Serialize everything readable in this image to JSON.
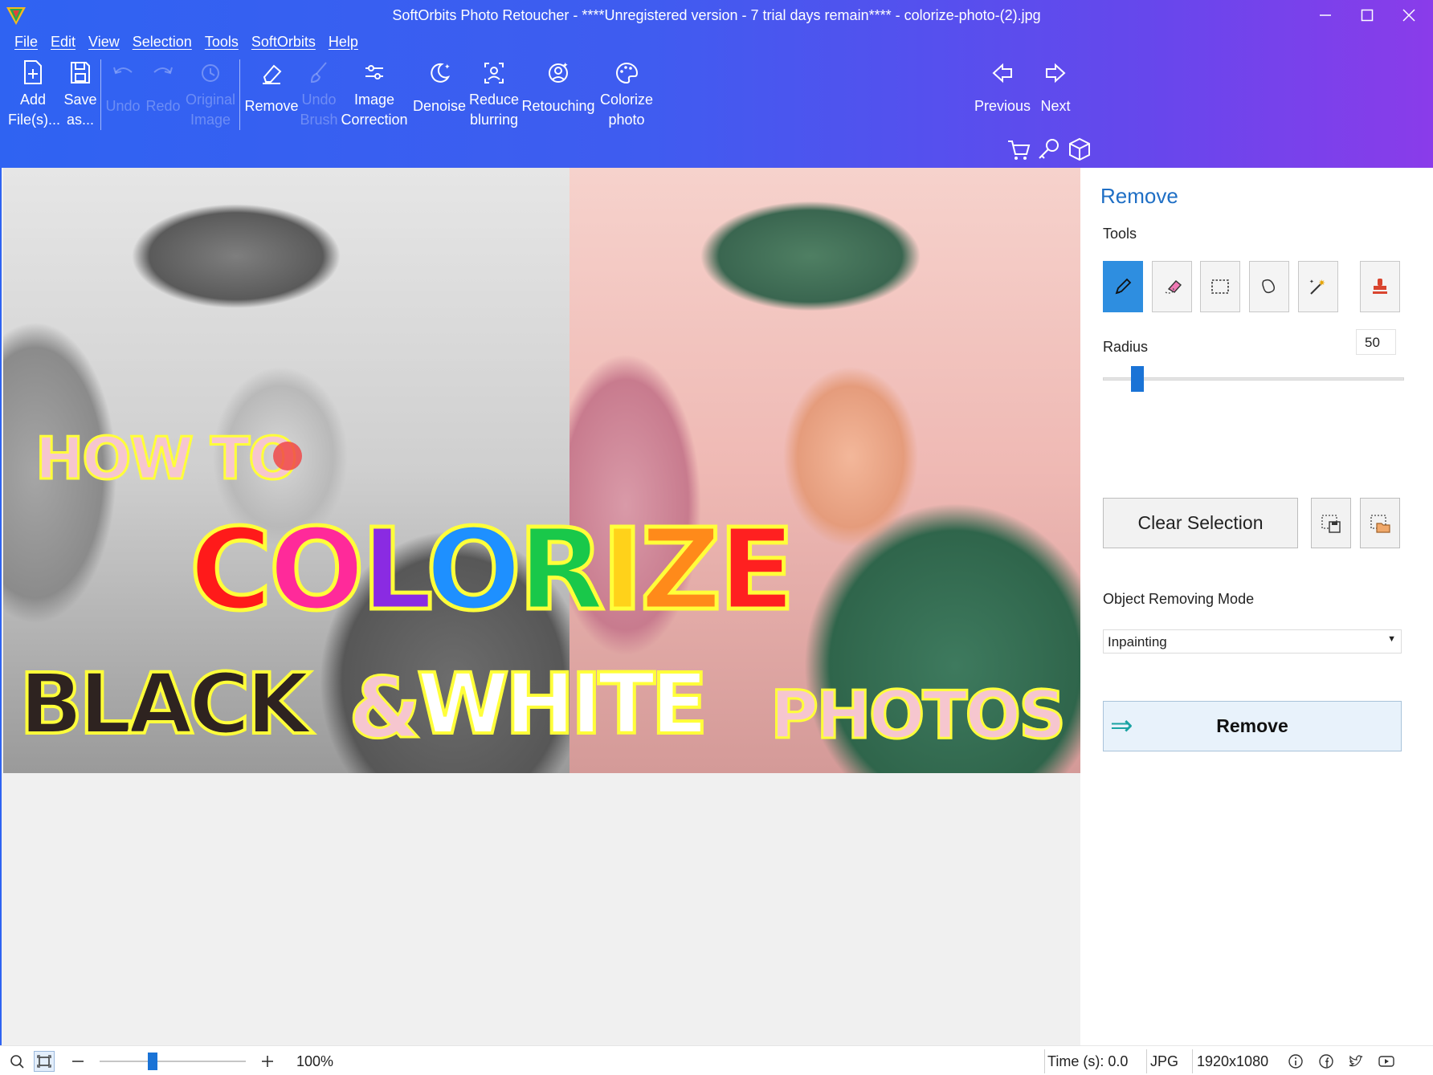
{
  "window": {
    "title": "SoftOrbits Photo Retoucher - ****Unregistered version - 7 trial days remain**** - colorize-photo-(2).jpg"
  },
  "menu": [
    "File",
    "Edit",
    "View",
    "Selection",
    "Tools",
    "SoftOrbits",
    "Help"
  ],
  "ribbon": {
    "add_files": "Add\nFile(s)...",
    "save_as": "Save\nas...",
    "undo": "Undo",
    "redo": "Redo",
    "original_image": "Original\nImage",
    "remove": "Remove",
    "undo_brush": "Undo\nBrush",
    "image_correction": "Image\nCorrection",
    "denoise": "Denoise",
    "reduce_blurring": "Reduce\nblurring",
    "retouching": "Retouching",
    "colorize_photo": "Colorize\nphoto",
    "previous": "Previous",
    "next": "Next"
  },
  "image_overlay": {
    "line1": "HOW TO",
    "line2_letters": [
      {
        "ch": "C",
        "color": "#ff1a1a"
      },
      {
        "ch": "O",
        "color": "#ff2a9a"
      },
      {
        "ch": "L",
        "color": "#8a2be2"
      },
      {
        "ch": "O",
        "color": "#1e90ff"
      },
      {
        "ch": "R",
        "color": "#19c84a"
      },
      {
        "ch": "I",
        "color": "#ffd21a"
      },
      {
        "ch": "Z",
        "color": "#ff8a1a"
      },
      {
        "ch": "E",
        "color": "#ff2020"
      }
    ],
    "line3_black": "BLACK",
    "line3_amp": "&",
    "line3_white": "WHITE",
    "line3_photos": "PHOTOS"
  },
  "panel": {
    "title": "Remove",
    "tools_label": "Tools",
    "tools": [
      "pencil-icon",
      "eraser-icon",
      "rect-select-icon",
      "lasso-icon",
      "magic-wand-icon",
      "stamp-icon"
    ],
    "radius_label": "Radius",
    "radius_value": "50",
    "radius_min": 1,
    "radius_max": 500,
    "clear_selection": "Clear Selection",
    "mode_label": "Object Removing Mode",
    "mode_value": "Inpainting",
    "remove_button": "Remove"
  },
  "statusbar": {
    "zoom": "100%",
    "zoom_fraction": 0.35,
    "time": "Time (s): 0.0",
    "format": "JPG",
    "dimensions": "1920x1080"
  },
  "colors": {
    "header_start": "#2f63f2",
    "header_end": "#8a3cea",
    "accent": "#1a73d6",
    "panel_title": "#1f6fc5"
  }
}
